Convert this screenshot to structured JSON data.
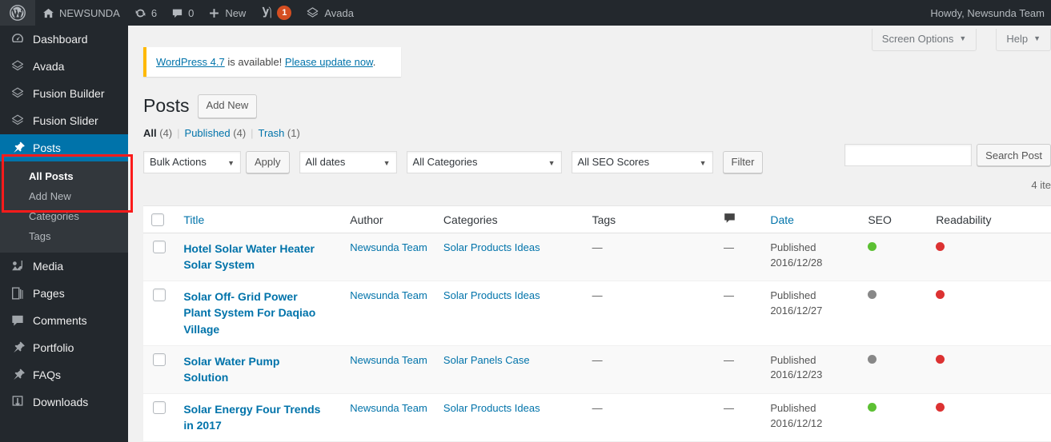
{
  "adminbar": {
    "logo_icon": "wordpress-logo-icon",
    "site_name": "NEWSUNDA",
    "home_icon": "home-icon",
    "updates_icon": "updates-icon",
    "updates_count": "6",
    "comments_icon": "comment-bubble-icon",
    "comments_count": "0",
    "new_icon": "plus-icon",
    "new_label": "New",
    "yoast_icon": "yoast-seo-icon",
    "yoast_badge": "1",
    "avada_icon": "avada-icon",
    "avada_label": "Avada",
    "howdy": "Howdy, Newsunda Team"
  },
  "screen_meta": {
    "screen_options": "Screen Options",
    "help": "Help",
    "caret": "▼"
  },
  "sidebar": {
    "items": [
      {
        "label": "Dashboard",
        "icon": "dashboard-icon",
        "current": false
      },
      {
        "label": "Avada",
        "icon": "avada-icon",
        "current": false
      },
      {
        "label": "Fusion Builder",
        "icon": "fusion-builder-icon",
        "current": false
      },
      {
        "label": "Fusion Slider",
        "icon": "fusion-slider-icon",
        "current": false
      },
      {
        "label": "Posts",
        "icon": "pin-icon",
        "current": true
      },
      {
        "label": "Media",
        "icon": "media-icon",
        "current": false
      },
      {
        "label": "Pages",
        "icon": "pages-icon",
        "current": false
      },
      {
        "label": "Comments",
        "icon": "comment-bubble-icon",
        "current": false
      },
      {
        "label": "Portfolio",
        "icon": "pin-icon",
        "current": false
      },
      {
        "label": "FAQs",
        "icon": "pin-icon",
        "current": false
      },
      {
        "label": "Downloads",
        "icon": "download-icon",
        "current": false
      }
    ],
    "submenu": [
      {
        "label": "All Posts",
        "current": true
      },
      {
        "label": "Add New",
        "current": false
      },
      {
        "label": "Categories",
        "current": false
      },
      {
        "label": "Tags",
        "current": false
      }
    ],
    "highlight_color": "#fb1b1b",
    "current_bg": "#0073aa"
  },
  "notice": {
    "link_version": "WordPress 4.7",
    "middle": " is available! ",
    "link_update": "Please update now",
    "end": "."
  },
  "page": {
    "title": "Posts",
    "add_new": "Add New"
  },
  "views": {
    "all_label": "All",
    "all_count": "(4)",
    "published_label": "Published",
    "published_count": "(4)",
    "trash_label": "Trash",
    "trash_count": "(1)",
    "separator": "|"
  },
  "search": {
    "value": "",
    "placeholder": "",
    "button": "Search Post"
  },
  "tablenav": {
    "bulk_actions": "Bulk Actions",
    "apply": "Apply",
    "all_dates": "All dates",
    "all_categories": "All Categories",
    "all_seo_scores": "All SEO Scores",
    "filter": "Filter",
    "displaying_num": "4 ite",
    "caret": "▼"
  },
  "table": {
    "columns": [
      {
        "label": "Title",
        "sortable": true
      },
      {
        "label": "Author",
        "sortable": false
      },
      {
        "label": "Categories",
        "sortable": false
      },
      {
        "label": "Tags",
        "sortable": false
      },
      {
        "label": "",
        "sortable": false,
        "icon": "comment-bubble-icon"
      },
      {
        "label": "Date",
        "sortable": true
      },
      {
        "label": "SEO",
        "sortable": false
      },
      {
        "label": "Readability",
        "sortable": false
      }
    ],
    "rows": [
      {
        "title": "Hotel Solar Water Heater Solar System",
        "author": "Newsunda Team",
        "categories": "Solar Products Ideas",
        "tags": "—",
        "comments": "—",
        "date_status": "Published",
        "date": "2016/12/28",
        "seo_color": "#5cc033",
        "readability_color": "#dc3232"
      },
      {
        "title": "Solar Off- Grid Power Plant System For Daqiao Village",
        "author": "Newsunda Team",
        "categories": "Solar Products Ideas",
        "tags": "—",
        "comments": "—",
        "date_status": "Published",
        "date": "2016/12/27",
        "seo_color": "#888888",
        "readability_color": "#dc3232"
      },
      {
        "title": "Solar Water Pump Solution",
        "author": "Newsunda Team",
        "categories": "Solar Panels Case",
        "tags": "—",
        "comments": "—",
        "date_status": "Published",
        "date": "2016/12/23",
        "seo_color": "#888888",
        "readability_color": "#dc3232"
      },
      {
        "title": "Solar Energy Four Trends in 2017",
        "author": "Newsunda Team",
        "categories": "Solar Products Ideas",
        "tags": "—",
        "comments": "—",
        "date_status": "Published",
        "date": "2016/12/12",
        "seo_color": "#5cc033",
        "readability_color": "#dc3232"
      }
    ]
  }
}
